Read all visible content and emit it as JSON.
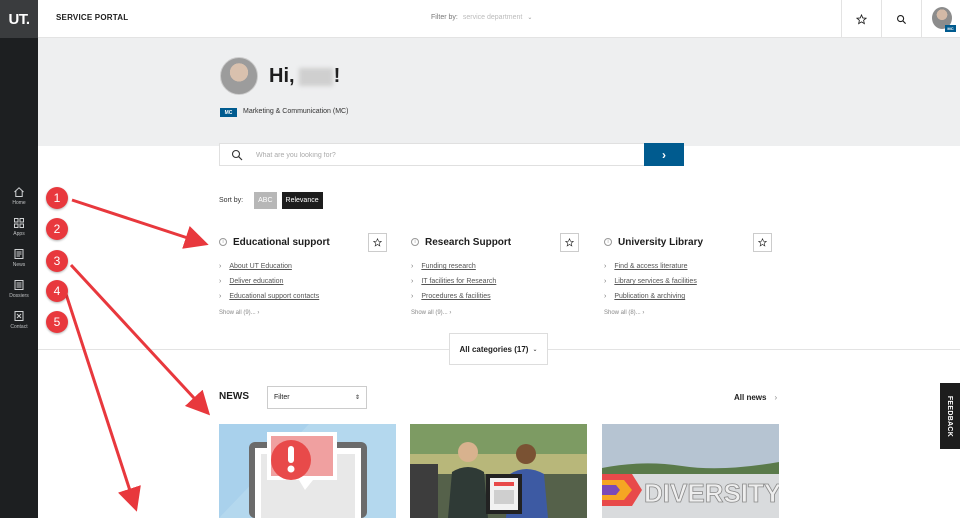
{
  "sidebar": {
    "logo": "UT.",
    "items": [
      {
        "label": "Home",
        "icon": "home-icon"
      },
      {
        "label": "Apps",
        "icon": "apps-icon"
      },
      {
        "label": "News",
        "icon": "news-icon"
      },
      {
        "label": "Dossiers",
        "icon": "dossiers-icon"
      },
      {
        "label": "Contact",
        "icon": "contact-icon"
      }
    ]
  },
  "topbar": {
    "title": "SERVICE PORTAL",
    "filter_label": "Filter by:",
    "filter_placeholder": "service department",
    "avatar_badge": "MC"
  },
  "hero": {
    "greeting_prefix": "Hi,",
    "greeting_suffix": "!",
    "dept_badge": "MC",
    "dept_name": "Marketing & Communication (MC)"
  },
  "search": {
    "placeholder": "What are you looking for?",
    "button_glyph": "›"
  },
  "sort": {
    "label": "Sort by:",
    "abc": "ABC",
    "relevance": "Relevance"
  },
  "categories": [
    {
      "title": "Educational support",
      "links": [
        "About UT Education",
        "Deliver education",
        "Educational support contacts"
      ],
      "show_all": "Show all (9)... ›"
    },
    {
      "title": "Research Support",
      "links": [
        "Funding research",
        "IT facilities for Research",
        "Procedures & facilities"
      ],
      "show_all": "Show all (9)... ›"
    },
    {
      "title": "University Library",
      "links": [
        "Find & access literature",
        "Library services & facilities",
        "Publication & archiving"
      ],
      "show_all": "Show all (8)... ›"
    }
  ],
  "all_categories": {
    "label": "All categories (17)",
    "chevron": "⌄"
  },
  "news": {
    "title": "NEWS",
    "filter_value": "Filter",
    "all_news": "All news",
    "card3_text": "DIVERSITY"
  },
  "feedback": "FEEDBACK",
  "annotations": [
    "1",
    "2",
    "3",
    "4",
    "5"
  ],
  "colors": {
    "accent": "#005b8f",
    "sidebar": "#1d1f21",
    "annotation": "#e8383d"
  }
}
